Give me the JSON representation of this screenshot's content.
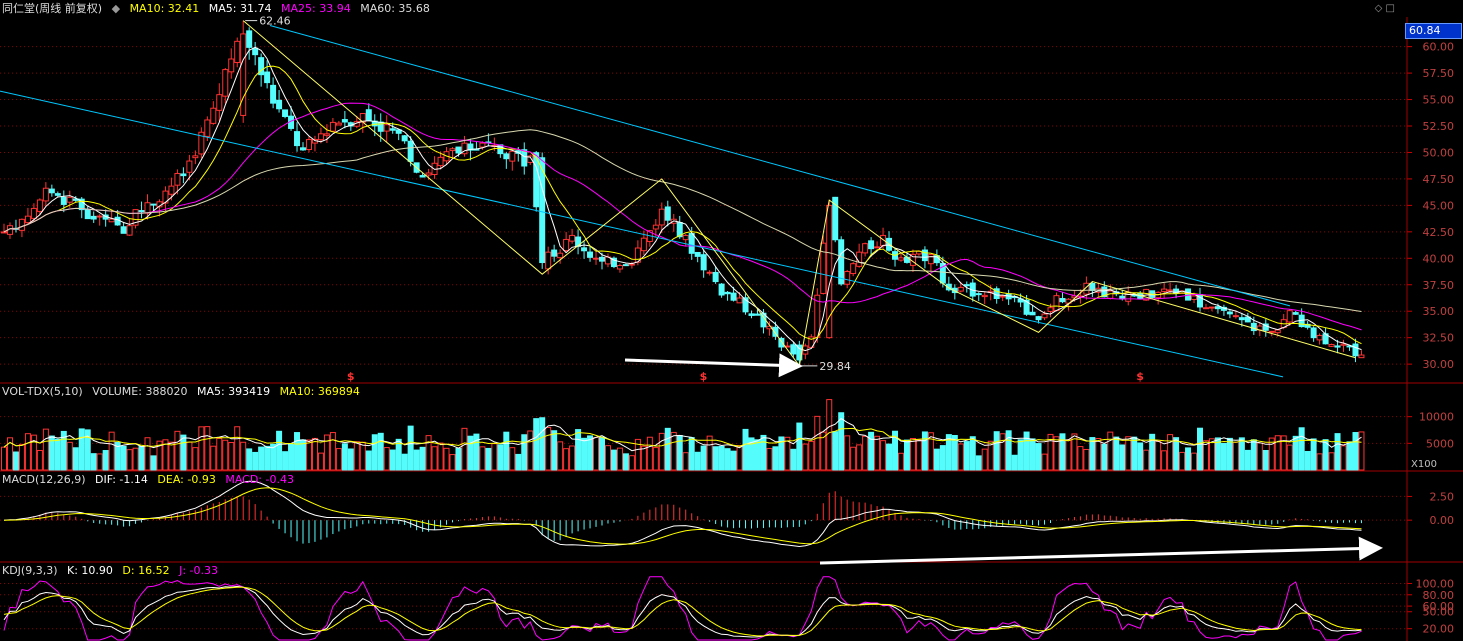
{
  "colors": {
    "up": "#ff3333",
    "down": "#54fcfc",
    "ma5": "#ffffff",
    "ma10": "#ffff00",
    "ma25": "#ff00ff",
    "ma60": "#00ff00",
    "grid": "#8b0000",
    "channel": "#00c8ff",
    "zigzag": "#ffff66",
    "arrow": "#ffffff"
  },
  "header": {
    "main": {
      "stock": "同仁堂(周线 前复权)",
      "icon": "diamond-icon",
      "ma10": "MA10: 32.41",
      "ma5": "MA5: 31.74",
      "ma25": "MA25: 33.94",
      "ma60": "MA60: 35.68"
    },
    "vol": {
      "title": "VOL-TDX(5,10)",
      "volume": "VOLUME: 388020",
      "ma5": "MA5: 393419",
      "ma10": "MA10: 369894"
    },
    "macd": {
      "title": "MACD(12,26,9)",
      "dif": "DIF: -1.14",
      "dea": "DEA: -0.93",
      "macd": "MACD: -0.43"
    },
    "kdj": {
      "title": "KDJ(9,3,3)",
      "k": "K: 10.90",
      "d": "D: 16.52",
      "j": "J: -0.33"
    }
  },
  "price_badge": "60.84",
  "annotations": {
    "high": "62.46",
    "low": "29.84"
  },
  "markers": [
    "$",
    "$",
    "$"
  ],
  "vol_unit": "X100",
  "chart_data": {
    "type": "candlestick",
    "candles": [],
    "anchors": [
      {
        "i": 0,
        "p": 42.0
      },
      {
        "i": 8,
        "p": 46.5
      },
      {
        "i": 14,
        "p": 44.0
      },
      {
        "i": 20,
        "p": 43.0
      },
      {
        "i": 30,
        "p": 48.0
      },
      {
        "i": 35,
        "p": 54.0
      },
      {
        "i": 40,
        "p": 61.5
      },
      {
        "i": 45,
        "p": 55.0
      },
      {
        "i": 50,
        "p": 50.0
      },
      {
        "i": 55,
        "p": 53.0
      },
      {
        "i": 60,
        "p": 53.5
      },
      {
        "i": 65,
        "p": 52.0
      },
      {
        "i": 70,
        "p": 48.0
      },
      {
        "i": 75,
        "p": 50.0
      },
      {
        "i": 80,
        "p": 50.5
      },
      {
        "i": 85,
        "p": 50.0
      },
      {
        "i": 88,
        "p": 49.0
      },
      {
        "i": 90,
        "p": 39.5
      },
      {
        "i": 95,
        "p": 42.0
      },
      {
        "i": 100,
        "p": 39.5
      },
      {
        "i": 105,
        "p": 40.0
      },
      {
        "i": 110,
        "p": 44.5
      },
      {
        "i": 115,
        "p": 41.0
      },
      {
        "i": 120,
        "p": 37.0
      },
      {
        "i": 125,
        "p": 35.0
      },
      {
        "i": 130,
        "p": 32.0
      },
      {
        "i": 133,
        "p": 30.5
      },
      {
        "i": 135,
        "p": 32.5
      },
      {
        "i": 138,
        "p": 45.0
      },
      {
        "i": 140,
        "p": 37.5
      },
      {
        "i": 143,
        "p": 40.5
      },
      {
        "i": 147,
        "p": 42.0
      },
      {
        "i": 150,
        "p": 39.5
      },
      {
        "i": 155,
        "p": 40.5
      },
      {
        "i": 158,
        "p": 36.8
      },
      {
        "i": 163,
        "p": 37.0
      },
      {
        "i": 168,
        "p": 36.3
      },
      {
        "i": 173,
        "p": 34.0
      },
      {
        "i": 176,
        "p": 36.2
      },
      {
        "i": 182,
        "p": 37.3
      },
      {
        "i": 187,
        "p": 36.2
      },
      {
        "i": 193,
        "p": 36.8
      },
      {
        "i": 197,
        "p": 37.0
      },
      {
        "i": 202,
        "p": 35.0
      },
      {
        "i": 207,
        "p": 34.0
      },
      {
        "i": 212,
        "p": 33.0
      },
      {
        "i": 215,
        "p": 35.0
      },
      {
        "i": 218,
        "p": 33.0
      },
      {
        "i": 222,
        "p": 32.2
      },
      {
        "i": 226,
        "p": 31.2
      }
    ],
    "price_axis": {
      "ticks": [
        "30.00",
        "32.50",
        "35.00",
        "37.50",
        "40.00",
        "42.50",
        "45.00",
        "47.50",
        "50.00",
        "52.50",
        "55.00",
        "57.50",
        "60.00"
      ],
      "ylim": [
        28.5,
        62.8
      ]
    },
    "vol_axis": {
      "ticks": [
        "5000",
        "10000"
      ],
      "ylim": [
        0,
        13500
      ]
    },
    "macd_axis": {
      "ticks": [
        "0.00",
        "2.50"
      ],
      "ylim": [
        -4.2,
        3.6
      ]
    },
    "kdj_axis": {
      "ticks": [
        "20.00",
        "50.00",
        "60.00",
        "80.00",
        "100.00"
      ],
      "ylim": [
        0,
        115
      ]
    }
  }
}
